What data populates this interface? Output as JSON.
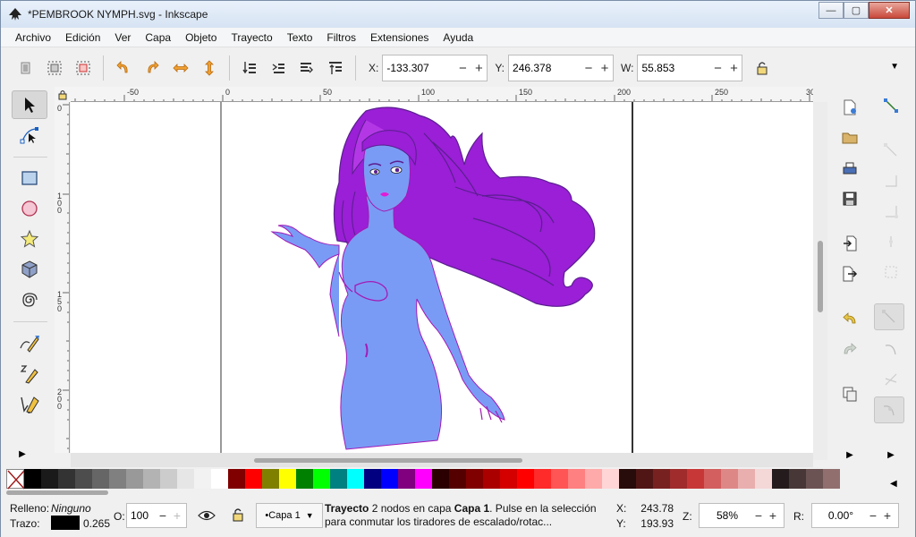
{
  "window": {
    "title": "*PEMBROOK NYMPH.svg - Inkscape",
    "minimize": "—",
    "maximize": "▢",
    "close": "✕"
  },
  "menu": [
    "Archivo",
    "Edición",
    "Ver",
    "Capa",
    "Objeto",
    "Trayecto",
    "Texto",
    "Filtros",
    "Extensiones",
    "Ayuda"
  ],
  "toolbar": {
    "x_label": "X:",
    "x_value": "-133.307",
    "y_label": "Y:",
    "y_value": "246.378",
    "w_label": "W:",
    "w_value": "55.853",
    "minus": "−",
    "plus": "+"
  },
  "ruler": {
    "h_labels": [
      "-50",
      "0",
      "50",
      "100",
      "150",
      "200",
      "250",
      "30"
    ],
    "v_labels": [
      "0",
      "1\n0\n0",
      "1\n5\n0",
      "2\n0\n0"
    ]
  },
  "palette": [
    "#000000",
    "#1a1a1a",
    "#333333",
    "#4d4d4d",
    "#666666",
    "#808080",
    "#999999",
    "#b3b3b3",
    "#cccccc",
    "#e6e6e6",
    "#f2f2f2",
    "#ffffff",
    "#800000",
    "#ff0000",
    "#808000",
    "#ffff00",
    "#008000",
    "#00ff00",
    "#008080",
    "#00ffff",
    "#000080",
    "#0000ff",
    "#800080",
    "#ff00ff",
    "#2b0000",
    "#550000",
    "#800000",
    "#aa0000",
    "#d40000",
    "#ff0000",
    "#ff2a2a",
    "#ff5555",
    "#ff8080",
    "#ffaaaa",
    "#ffd5d5",
    "#280b0b",
    "#501616",
    "#782121",
    "#a02c2c",
    "#c83737",
    "#d35f5f",
    "#de8787",
    "#e9afaf",
    "#f4d7d7",
    "#241c1c",
    "#483737",
    "#6c5353",
    "#916f6f"
  ],
  "status": {
    "fill_label": "Relleno:",
    "fill_value": "Ninguno",
    "stroke_label": "Trazo:",
    "stroke_width": "0.265",
    "opacity_label": "O:",
    "opacity_value": "100",
    "layer": "•Capa 1",
    "msg_bold1": "Trayecto",
    "msg_1": " 2 nodos en capa ",
    "msg_bold2": "Capa 1",
    "msg_2": ". Pulse en la selección para conmutar los tiradores de escalado/rotac...",
    "cursor_x_label": "X:",
    "cursor_x": "243.78",
    "cursor_y_label": "Y:",
    "cursor_y": "193.93",
    "zoom_label": "Z:",
    "zoom": "58%",
    "rot_label": "R:",
    "rotation": "0.00°"
  },
  "icons": {
    "app": "inkscape-logo-icon",
    "select": "selector-arrow-icon",
    "node": "node-edit-icon"
  }
}
